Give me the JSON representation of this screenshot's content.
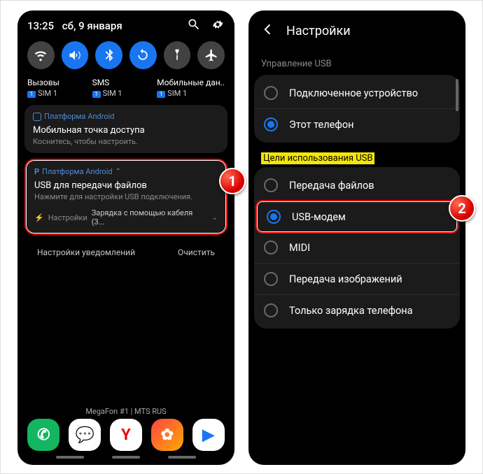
{
  "left": {
    "time": "13:25",
    "date": "сб, 9 января",
    "sim": [
      {
        "label": "Вызовы",
        "sub": "SIM 1"
      },
      {
        "label": "SMS",
        "sub": "SIM 1"
      },
      {
        "label": "Мобильные дан..",
        "sub": "SIM 1"
      }
    ],
    "notif1": {
      "app": "Платформа Android",
      "title": "Мобильная точка доступа",
      "subtitle": "Коснитесь, чтобы настроить."
    },
    "notif2": {
      "app": "Платформа Android",
      "title": "USB для передачи файлов",
      "subtitle": "Нажмите для настройки USB подключения.",
      "settings": "Настройки",
      "charging": "Зарядка с помощью кабеля (3..."
    },
    "actions": {
      "settings": "Настройки уведомлений",
      "clear": "Очистить"
    },
    "carrier": "MegaFon #1 | MTS RUS"
  },
  "right": {
    "header": "Настройки",
    "section1": "Управление USB",
    "group1": [
      {
        "label": "Подключенное устройство",
        "checked": false
      },
      {
        "label": "Этот телефон",
        "checked": true
      }
    ],
    "section2": "Цели использования USB",
    "group2": [
      {
        "label": "Передача файлов",
        "checked": false
      },
      {
        "label": "USB-модем",
        "checked": true,
        "highlight": true
      },
      {
        "label": "MIDI",
        "checked": false
      },
      {
        "label": "Передача изображений",
        "checked": false
      },
      {
        "label": "Только зарядка телефона",
        "checked": false
      }
    ]
  },
  "badges": {
    "one": "1",
    "two": "2"
  }
}
